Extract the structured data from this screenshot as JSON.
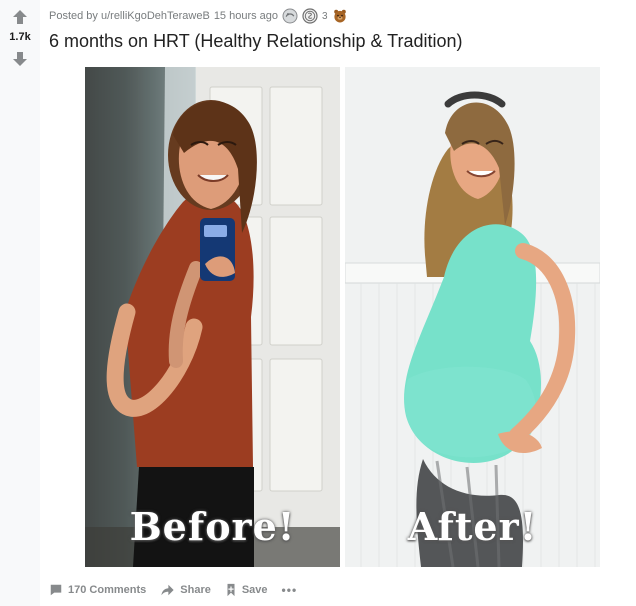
{
  "vote": {
    "score": "1.7k",
    "up_icon": "arrow-up-icon",
    "down_icon": "arrow-down-icon"
  },
  "meta": {
    "posted_by": "Posted by u/relliKgoDehTeraweB",
    "time": "15 hours ago",
    "award_count": "3"
  },
  "title": "6 months on HRT (Healthy Relationship & Tradition)",
  "media": {
    "before_caption": "Before!",
    "after_caption": "After!"
  },
  "footer": {
    "comments": "170 Comments",
    "share": "Share",
    "save": "Save",
    "more": "•••"
  },
  "colors": {
    "arrow": "#878a8c",
    "text": "#1a1a1b",
    "meta": "#787c7e"
  }
}
